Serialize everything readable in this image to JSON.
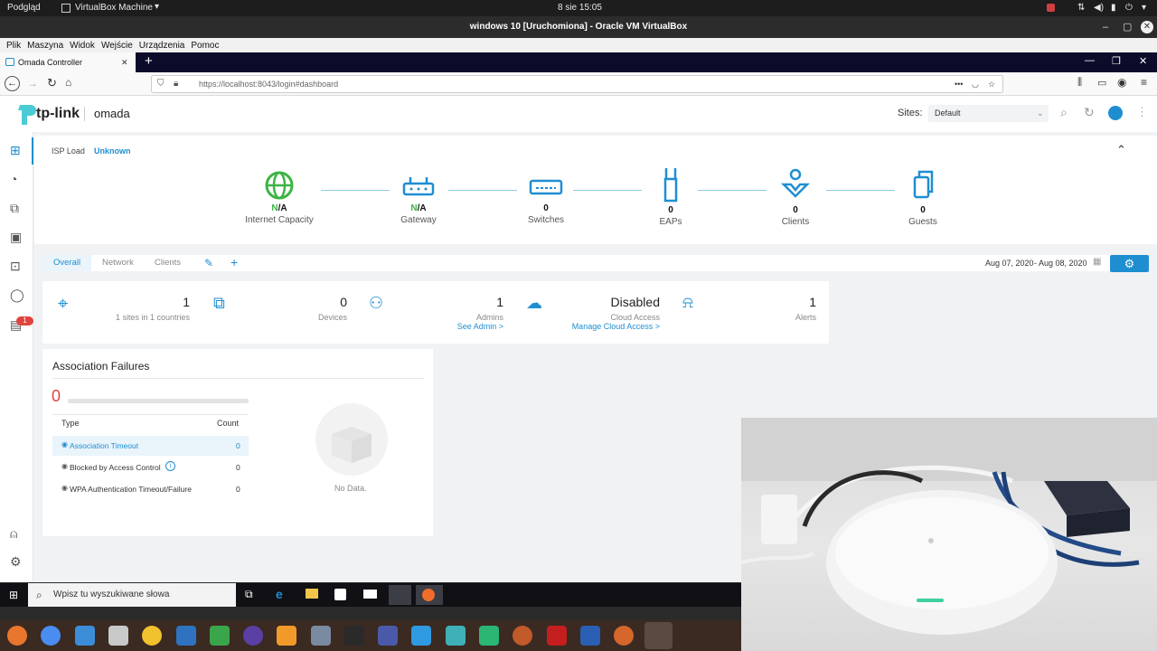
{
  "system_bar": {
    "left_app": "Podgląd",
    "machine_menu": "VirtualBox Machine",
    "datetime": "8 sie  15:05"
  },
  "vbox": {
    "title": "windows 10 [Uruchomiona] - Oracle VM VirtualBox",
    "menu": [
      "Plik",
      "Maszyna",
      "Widok",
      "Wejście",
      "Urządzenia",
      "Pomoc"
    ]
  },
  "browser": {
    "tab_title": "Omada Controller",
    "url": "https://localhost:8043/login#dashboard",
    "url_host": "localhost"
  },
  "omada": {
    "brand": "tp-link",
    "product": "omada",
    "sites_label": "Sites:",
    "sites_value": "Default",
    "isp_label": "ISP Load",
    "isp_value": "Unknown",
    "topology": [
      {
        "value": "N/A",
        "label": "Internet Capacity"
      },
      {
        "value": "N/A",
        "label": "Gateway"
      },
      {
        "value": "0",
        "label": "Switches"
      },
      {
        "value": "0",
        "label": "EAPs"
      },
      {
        "value": "0",
        "label": "Clients"
      },
      {
        "value": "0",
        "label": "Guests"
      }
    ],
    "tabs": [
      "Overall",
      "Network",
      "Clients"
    ],
    "date_from": "Aug 07, 2020",
    "date_to": "Aug 08, 2020",
    "stats": {
      "sites_value": "1",
      "sites_sub": "1 sites in 1 countries",
      "devices_value": "0",
      "devices_label": "Devices",
      "admins_value": "1",
      "admins_label": "Admins",
      "admins_link": "See Admin >",
      "cloud_value": "Disabled",
      "cloud_label": "Cloud Access",
      "cloud_link": "Manage Cloud Access >",
      "alerts_value": "1",
      "alerts_label": "Alerts"
    },
    "notification_badge": "1",
    "assoc": {
      "title": "Association Failures",
      "total": "0",
      "col_type": "Type",
      "col_count": "Count",
      "rows": [
        {
          "type": "Association Timeout",
          "count": "0"
        },
        {
          "type": "Blocked by Access Control",
          "count": "0"
        },
        {
          "type": "WPA Authentication Timeout/Failure",
          "count": "0"
        }
      ],
      "empty": "No Data."
    }
  },
  "windows": {
    "search_placeholder": "Wpisz tu wyszukiwane słowa"
  }
}
